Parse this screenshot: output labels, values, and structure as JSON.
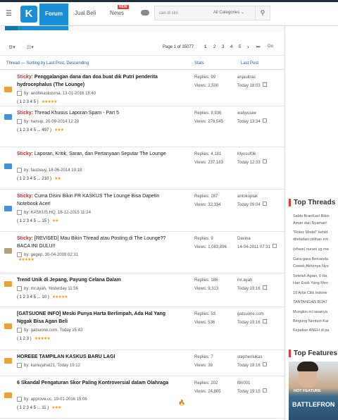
{
  "nav": {
    "logo": "K",
    "forum": "Forum",
    "jual_beli": "Jual Beli",
    "news": "News",
    "news_badge": "NEW",
    "search_placeholder": "cari di sini",
    "category": "All Categories"
  },
  "toolbar": {
    "page_info": "Page 1 of 35077",
    "pages": [
      "1",
      "2",
      "3",
      "4",
      "5"
    ],
    "go": "Go"
  },
  "table": {
    "col_thread": "Thread — Sorting by Last Post, Descending",
    "col_stats": "Stats",
    "col_last": "Last Post"
  },
  "rows": [
    {
      "sticky": "Sticky:",
      "title": "Penggalangan dana dan doa buat dik Putri penderita hydrocephalus (The Lounge)",
      "title_bold": true,
      "by": "by:  andhikaskusma, 13-01-2016 18:40",
      "pages": "( 1  2  3  4  5 )",
      "stars": "★★★★★",
      "replies": "Replies: 99",
      "views": "Views: 2,500",
      "last_user": "anjaultras",
      "last_time": "Today 18:03"
    },
    {
      "sticky": "Sticky:",
      "title": "Thread Khusus Laporan Spam - Part 5",
      "title_bold": false,
      "by": "by:  hansip, 20-09-2014 12:29",
      "pages": "( 1  2  3  4  5 ... 497 )",
      "stars": "★★★",
      "replies": "Replies: 9,936",
      "views": "Views: 278,545",
      "last_user": "wahyusee",
      "last_time": "Today 13:34"
    },
    {
      "sticky": "Sticky:",
      "title": "Laporan, Kritik, Saran, dan Pertanyaan Seputar The Lounge",
      "title_bold": false,
      "by": "by:  fauzieuy, 18-06-2014 10:18",
      "pages": "( 1  2  3  4  5 ... 210 )",
      "stars": "★★",
      "replies": "Replies: 4,181",
      "views": "Views: 237,183",
      "last_user": "Myusuf06",
      "last_time": "Today 12:33"
    },
    {
      "sticky": "Sticky:",
      "title": "Cuma Disini Bikin FR KASKUS The Lounge Bisa Dapetin Notebook Acer!",
      "title_bold": false,
      "by": "by:  KASKUS.HQ, 16-12-2015 11:24",
      "pages": "( 1  2  3  4  5 ... 15 )",
      "stars": "★★",
      "replies": "Replies: 287",
      "views": "Views: 32,334",
      "last_user": "antokoplak",
      "last_time": "Today 09:04"
    },
    {
      "sticky": "Sticky:",
      "title": "[REVISED] Mau Bikin Thread atau Posting di The Lounge?? BACA INI DULU!!",
      "title_bold": false,
      "by": "by:  gegep, 30-04-2009 02:31",
      "pages": "",
      "stars": "★★★★★",
      "replies": "Replies: 9",
      "views": "Views: 1,083,896",
      "last_user": "Davina",
      "last_time": "14-04-2011 07:31"
    },
    {
      "sticky": "",
      "title": "Trend Unik di Jepang, Payung Celana Dalam",
      "title_bold": true,
      "by": "by:  mr.ayah, Yesterday 11:56",
      "pages": "( 1  2  3  4  5 ... 10 )",
      "stars": "★★★★★",
      "replies": "Replies: 186",
      "views": "Views: 9,313",
      "last_user": "mr.ayah",
      "last_time": "Today 19:16"
    },
    {
      "sticky": "",
      "title": "[GATSUONE INFO] Meski Punya Harta Berlimpah, Ada Hal Yang Nggak Bisa Agan Beli",
      "title_bold": true,
      "by": "by:  gatsuone.com, Today 15:43",
      "pages": "( 1  2  3 )",
      "stars": "★★★★★",
      "replies": "Replies: 53",
      "views": "Views: 536",
      "last_user": "gatsuone.com",
      "last_time": "Today 19:16"
    },
    {
      "sticky": "",
      "title": "HOREEE TAMPILAN KASKUS BARU LAGI",
      "title_bold": true,
      "by": "by:  kamujahat21, Today 19:12",
      "pages": "",
      "stars": "",
      "replies": "Replies: 7",
      "views": "Views: 38",
      "last_user": "stephenlukas",
      "last_time": "Today 19:16"
    },
    {
      "sticky": "",
      "title": "6 Skandal Pengaturan Skor Paling Kontroversial dalam Olahraga",
      "title_bold": true,
      "by": "by:  approve.cc, 19-01-2016 15:06",
      "pages": "( 1  2  3  4  5 ... 11 )",
      "stars": "★★★",
      "replies": "Replies: 202",
      "views": "Views: 24,805",
      "last_user": "f8n001",
      "last_time": "Today 19:15"
    }
  ],
  "top_threads": {
    "title": "Top Threads",
    "items": [
      "Saldo BranKas! Bikin",
      "Aman dan Nyaman!",
      "\"Roles Model\" kehid",
      "diteladani pilihan em",
      "(share) nurani yg ma",
      "Gara-gara Bercanda",
      "Cewek Akhirnya Nyu",
      "Setelah Agian, 6 Ha",
      "Hari Esok Yang Men",
      "10 Artis Cilik Indone",
      "TANTANGAN BUAT",
      "Mungkin ini rasanya",
      "Bingung Nentuin Kar",
      "Kejadian ANEH di pa"
    ]
  },
  "top_features": {
    "title": "Top Features",
    "label": "HOT FEATURE",
    "game": "BATTLEFRON"
  }
}
